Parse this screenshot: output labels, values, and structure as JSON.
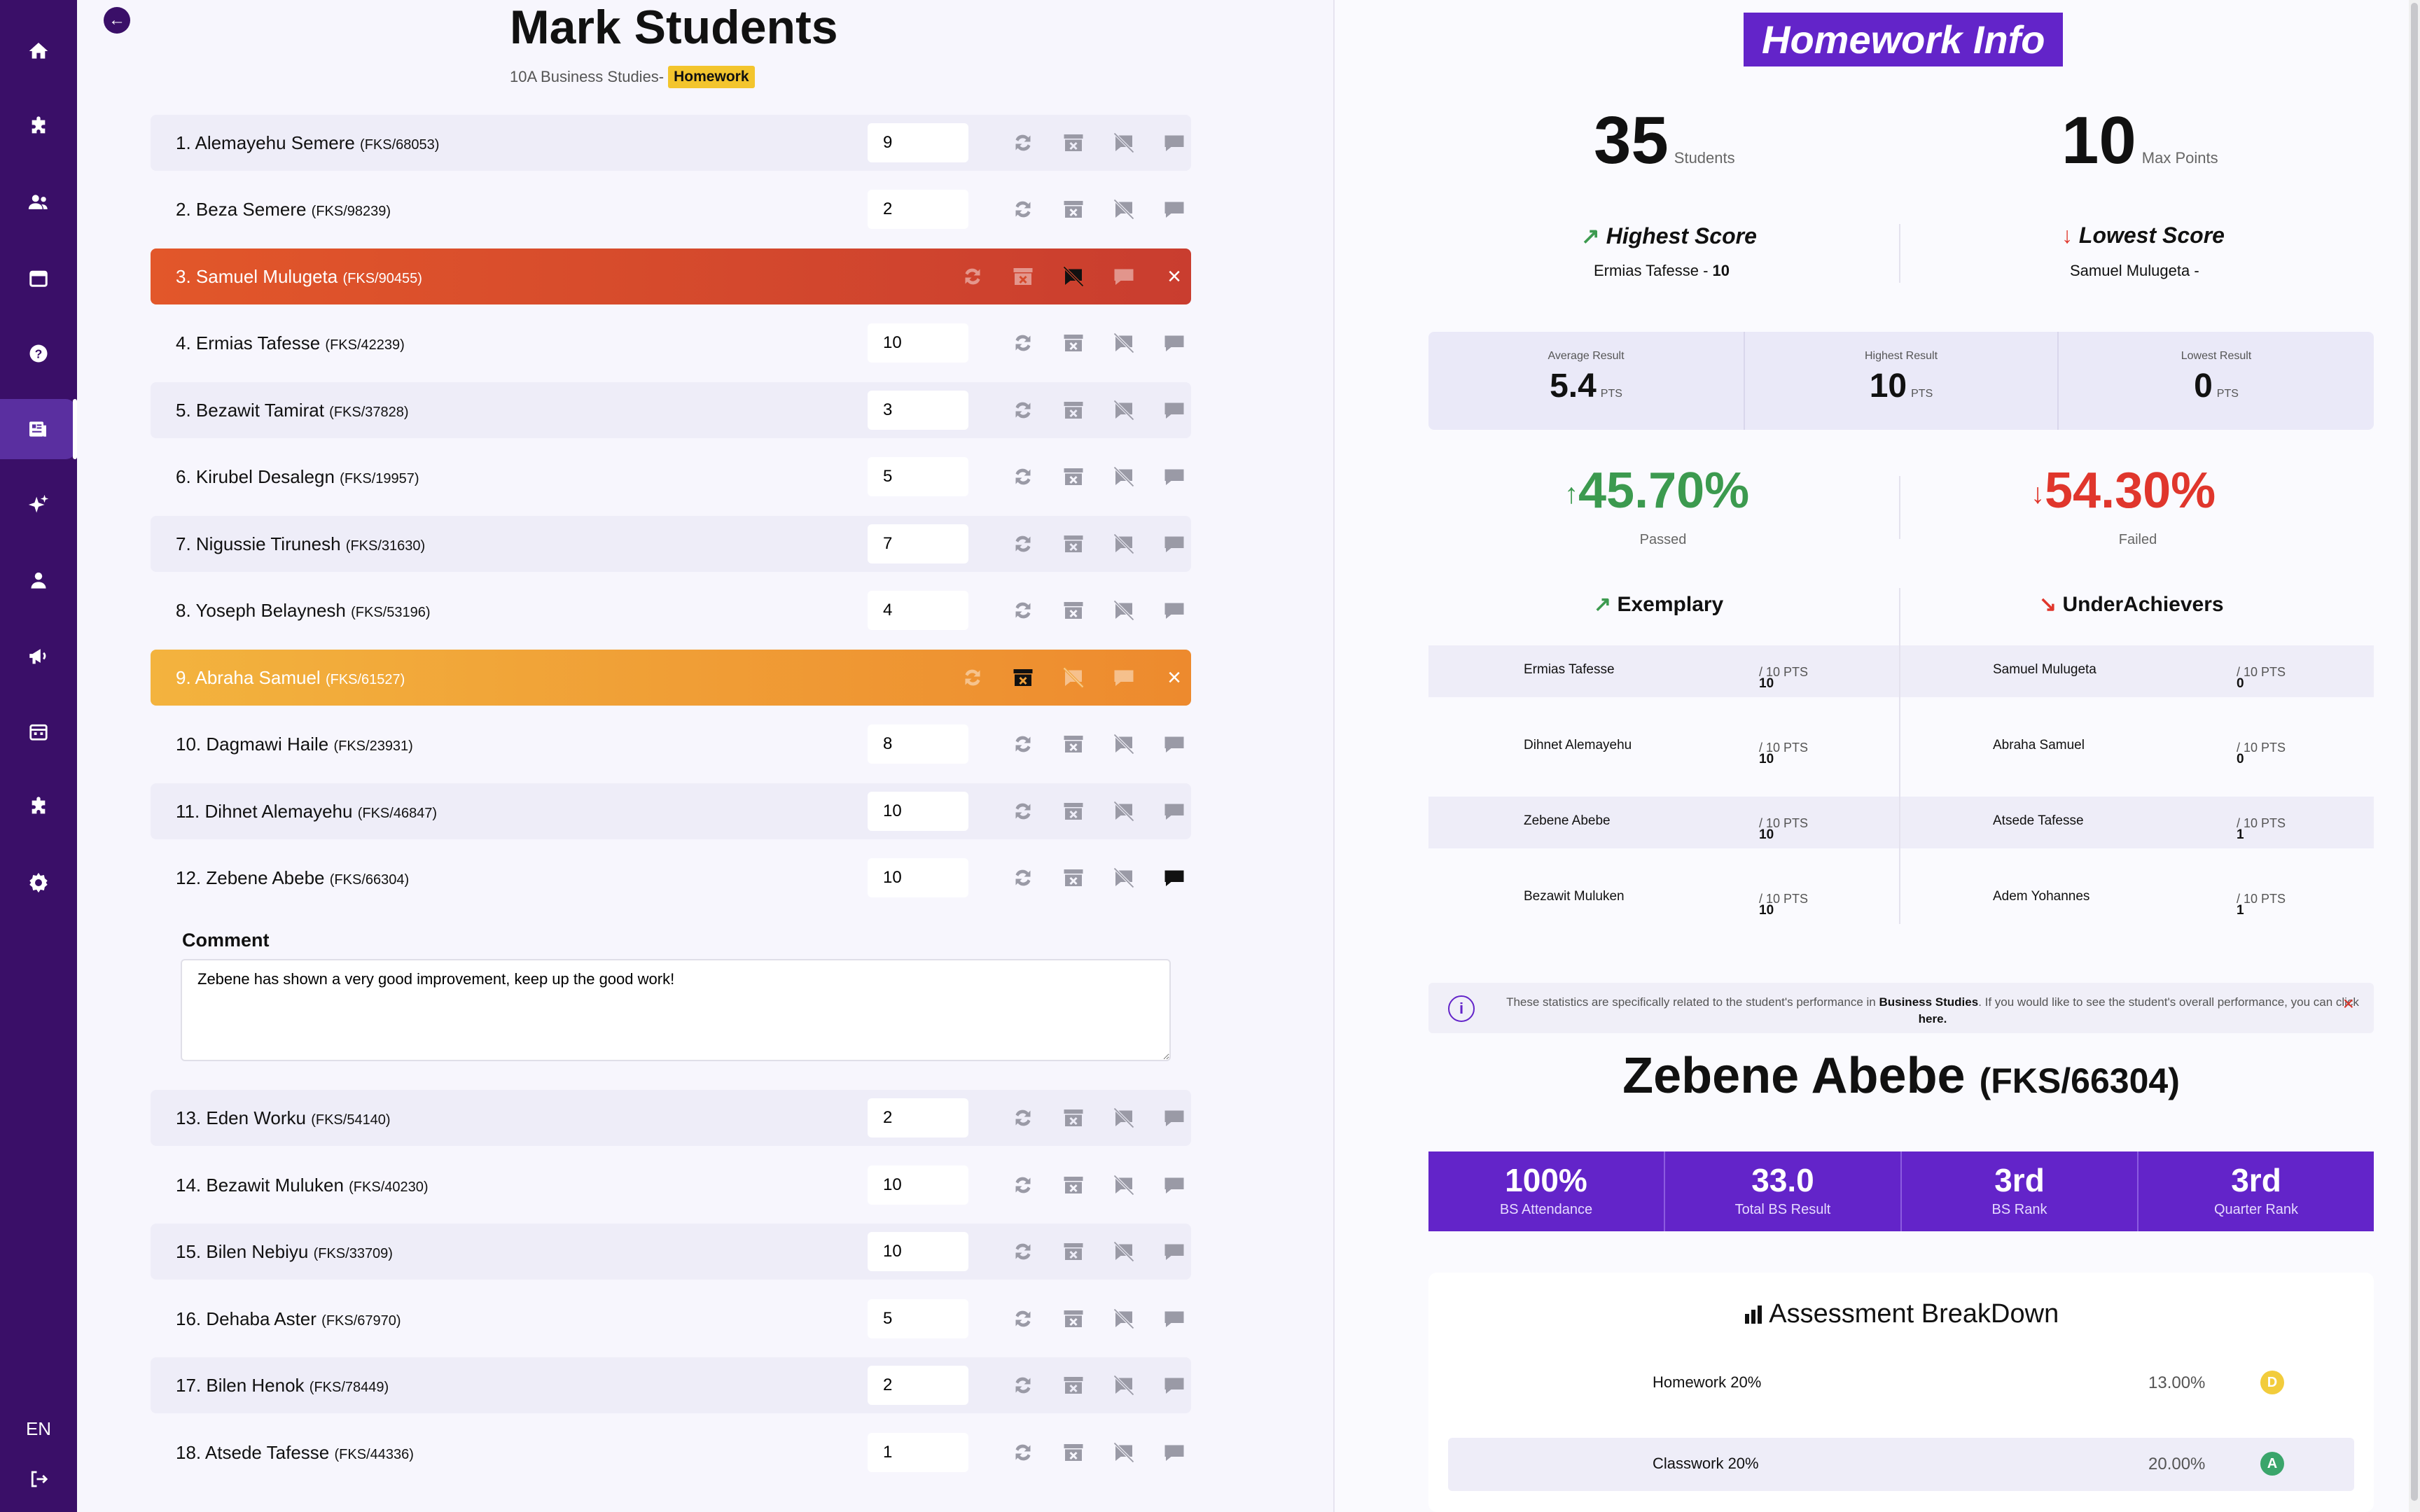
{
  "sidebar": {
    "items": [
      {
        "icon": "home-icon"
      },
      {
        "icon": "puzzle-icon"
      },
      {
        "icon": "users-icon"
      },
      {
        "icon": "calendar-icon"
      },
      {
        "icon": "help-icon"
      },
      {
        "icon": "newspaper-icon",
        "active": true
      },
      {
        "icon": "sparkles-icon"
      },
      {
        "icon": "user-icon"
      },
      {
        "icon": "megaphone-icon"
      },
      {
        "icon": "schedule-icon"
      },
      {
        "icon": "puzzle-icon"
      },
      {
        "icon": "settings-icon"
      }
    ],
    "language": "EN",
    "logout_icon": "logout-icon"
  },
  "main": {
    "title": "Mark Students",
    "subtitle": "10A Business Studies-",
    "tag": "Homework",
    "students": [
      {
        "name": "1. Alemayehu Semere",
        "code": "(FKS/68053)",
        "score": "9"
      },
      {
        "name": "2. Beza Semere",
        "code": "(FKS/98239)",
        "score": "2"
      },
      {
        "name": "3. Samuel Mulugeta",
        "code": "(FKS/90455)",
        "score": ""
      },
      {
        "name": "4. Ermias Tafesse",
        "code": "(FKS/42239)",
        "score": "10"
      },
      {
        "name": "5. Bezawit Tamirat",
        "code": "(FKS/37828)",
        "score": "3"
      },
      {
        "name": "6. Kirubel Desalegn",
        "code": "(FKS/19957)",
        "score": "5"
      },
      {
        "name": "7. Nigussie Tirunesh",
        "code": "(FKS/31630)",
        "score": "7"
      },
      {
        "name": "8. Yoseph Belaynesh",
        "code": "(FKS/53196)",
        "score": "4"
      },
      {
        "name": "9. Abraha Samuel",
        "code": "(FKS/61527)",
        "score": ""
      },
      {
        "name": "10. Dagmawi Haile",
        "code": "(FKS/23931)",
        "score": "8"
      },
      {
        "name": "11. Dihnet Alemayehu",
        "code": "(FKS/46847)",
        "score": "10"
      },
      {
        "name": "12. Zebene Abebe",
        "code": "(FKS/66304)",
        "score": "10"
      },
      {
        "name": "13. Eden Worku",
        "code": "(FKS/54140)",
        "score": "2"
      },
      {
        "name": "14. Bezawit Muluken",
        "code": "(FKS/40230)",
        "score": "10"
      },
      {
        "name": "15. Bilen Nebiyu",
        "code": "(FKS/33709)",
        "score": "10"
      },
      {
        "name": "16. Dehaba Aster",
        "code": "(FKS/67970)",
        "score": "5"
      },
      {
        "name": "17. Bilen Henok",
        "code": "(FKS/78449)",
        "score": "2"
      },
      {
        "name": "18. Atsede Tafesse",
        "code": "(FKS/44336)",
        "score": "1"
      }
    ],
    "comment_label": "Comment",
    "comment_value": "Zebene has shown a very good improvement, keep up the good work!",
    "row_icons": [
      "refresh-icon",
      "archive-x-icon",
      "comment-off-icon",
      "chat-icon"
    ],
    "close_icon": "close-icon"
  },
  "info": {
    "title": "Homework Info",
    "students_count": "35",
    "students_label": "Students",
    "max_points": "10",
    "max_points_label": "Max Points",
    "highest_label": "Highest Score",
    "highest_name": "Ermias Tafesse -",
    "highest_value": "10",
    "lowest_label": "Lowest Score",
    "lowest_name": "Samuel Mulugeta -",
    "average_label": "Average Result",
    "average_value": "5.4",
    "highest_result_label": "Highest Result",
    "highest_result_value": "10",
    "lowest_result_label": "Lowest Result",
    "lowest_result_value": "0",
    "pts": "PTS",
    "passed_pct": "45.70%",
    "passed_label": "Passed",
    "failed_pct": "54.30%",
    "failed_label": "Failed",
    "exemplary_label": "Exemplary",
    "underachievers_label": "UnderAchievers",
    "pts_suffix": "/ 10 PTS",
    "exemplary": [
      {
        "name": "Ermias Tafesse",
        "score": "10"
      },
      {
        "name": "Dihnet Alemayehu",
        "score": "10"
      },
      {
        "name": "Zebene Abebe",
        "score": "10"
      },
      {
        "name": "Bezawit Muluken",
        "score": "10"
      }
    ],
    "underachievers": [
      {
        "name": "Samuel Mulugeta",
        "score": "0"
      },
      {
        "name": "Abraha Samuel",
        "score": "0"
      },
      {
        "name": "Atsede Tafesse",
        "score": "1"
      },
      {
        "name": "Adem Yohannes",
        "score": "1"
      }
    ],
    "notice_pre": "These statistics are specifically related to the student's performance in",
    "notice_subject": "Business Studies",
    "notice_post": ". If you would like to see the student's overall performance, you can click",
    "notice_link": "here.",
    "student_name": "Zebene Abebe",
    "student_code": "(FKS/66304)",
    "stats": [
      {
        "value": "100%",
        "label": "BS Attendance"
      },
      {
        "value": "33.0",
        "label": "Total BS Result"
      },
      {
        "value": "3rd",
        "label": "BS Rank"
      },
      {
        "value": "3rd",
        "label": "Quarter Rank"
      }
    ],
    "assessment_title": "Assessment BreakDown",
    "assessments": [
      {
        "name": "Homework 20%",
        "pct": "13.00%",
        "grade": "D",
        "color": "#f2cc3c"
      },
      {
        "name": "Classwork 20%",
        "pct": "20.00%",
        "grade": "A",
        "color": "#3aa56b"
      }
    ],
    "colors": {
      "accent": "#6324c9",
      "sidebar": "#3a0f68",
      "pass": "#3c9a4f",
      "fail": "#e0362c"
    }
  }
}
